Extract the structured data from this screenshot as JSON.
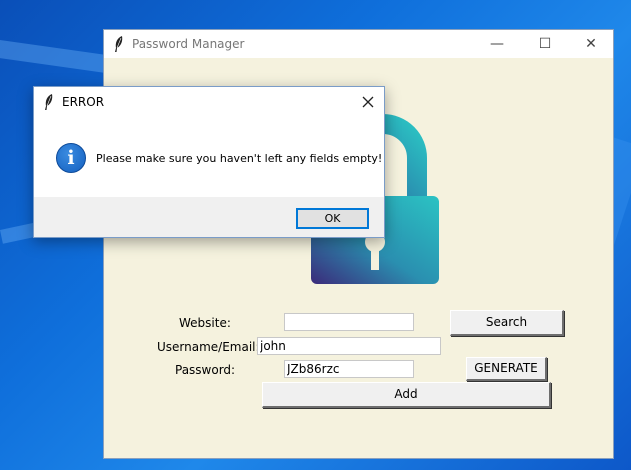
{
  "main_window": {
    "title": "Password Manager",
    "controls": {
      "minimize": "—",
      "maximize": "☐",
      "close": "✕"
    }
  },
  "form": {
    "website_label": "Website:",
    "website_value": "",
    "username_label": "Username/Email:",
    "username_value": "john",
    "password_label": "Password:",
    "password_value": "JZb86rzc",
    "search_label": "Search",
    "generate_label": "GENERATE",
    "add_label": "Add"
  },
  "dialog": {
    "title": "ERROR",
    "message": "Please make sure you haven't left any fields empty!",
    "ok_label": "OK",
    "icon": "info-icon",
    "close": "✕"
  },
  "colors": {
    "window_bg": "#f5f2de",
    "lock_gradient_start": "#3b2a7a",
    "lock_gradient_end": "#2bc3c3",
    "desktop": "#0f6fdb",
    "focus_border": "#0078d7"
  }
}
